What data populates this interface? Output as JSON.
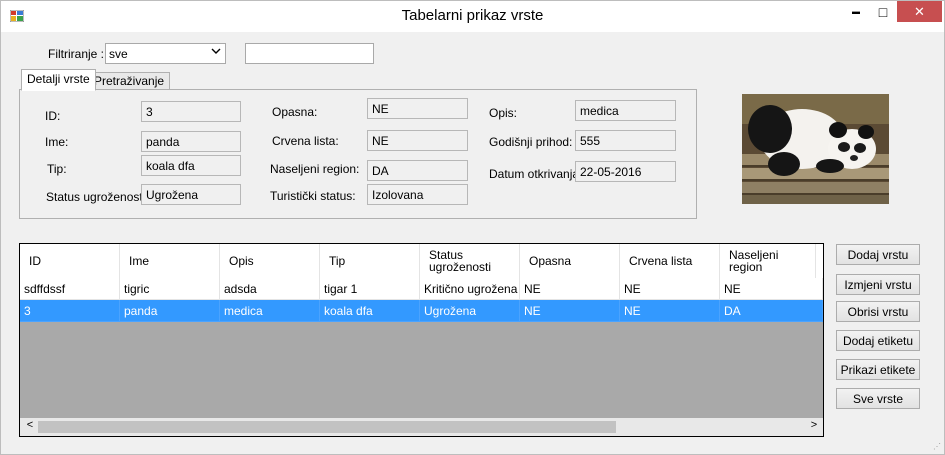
{
  "window": {
    "title": "Tabelarni prikaz vrste",
    "minimize_glyph": "▬",
    "maximize_glyph": "□",
    "close_glyph": "✕"
  },
  "filter": {
    "label": "Filtriranje :",
    "combo_value": "sve",
    "search_value": ""
  },
  "tabs": [
    {
      "label": "Detalji vrste",
      "active": true
    },
    {
      "label": "Pretraživanje",
      "active": false
    }
  ],
  "details": {
    "id": {
      "label": "ID:",
      "value": "3"
    },
    "ime": {
      "label": "Ime:",
      "value": "panda"
    },
    "tip": {
      "label": "Tip:",
      "value": "koala dfa"
    },
    "status": {
      "label": "Status ugroženosti:",
      "value": "Ugrožena"
    },
    "opasna": {
      "label": "Opasna:",
      "value": "NE"
    },
    "crvena_lista": {
      "label": "Crvena lista:",
      "value": "NE"
    },
    "naseljeni_region": {
      "label": "Naseljeni region:",
      "value": "DA"
    },
    "turisticki_status": {
      "label": "Turistički status:",
      "value": "Izolovana"
    },
    "opis": {
      "label": "Opis:",
      "value": "medica"
    },
    "prihod": {
      "label": "Godišnji prihod:",
      "value": "555"
    },
    "datum": {
      "label": "Datum otkrivanja:",
      "value": "22-05-2016"
    }
  },
  "table": {
    "columns": [
      "ID",
      "Ime",
      "Opis",
      "Tip",
      "Status ugroženosti",
      "Opasna",
      "Crvena lista",
      "Naseljeni region"
    ],
    "rows": [
      [
        "sdffdssf",
        "tigric",
        "adsda",
        "tigar 1",
        "Kritično ugrožena",
        "NE",
        "NE",
        "NE"
      ],
      [
        "3",
        "panda",
        "medica",
        "koala dfa",
        "Ugrožena",
        "NE",
        "NE",
        "DA"
      ]
    ],
    "selected_row": 1,
    "scroll_left_glyph": "<",
    "scroll_right_glyph": ">"
  },
  "buttons": {
    "dodaj_vrstu": "Dodaj vrstu",
    "izmjeni_vrstu": "Izmjeni vrstu",
    "obrisi_vrstu": "Obrisi vrstu",
    "dodaj_etiketu": "Dodaj etiketu",
    "prikazi_etikete": "Prikazi etikete",
    "sve_vrste": "Sve vrste"
  },
  "colors": {
    "selection": "#3399ff",
    "close_button": "#c74f50",
    "grid_background": "#a9a9a9"
  }
}
